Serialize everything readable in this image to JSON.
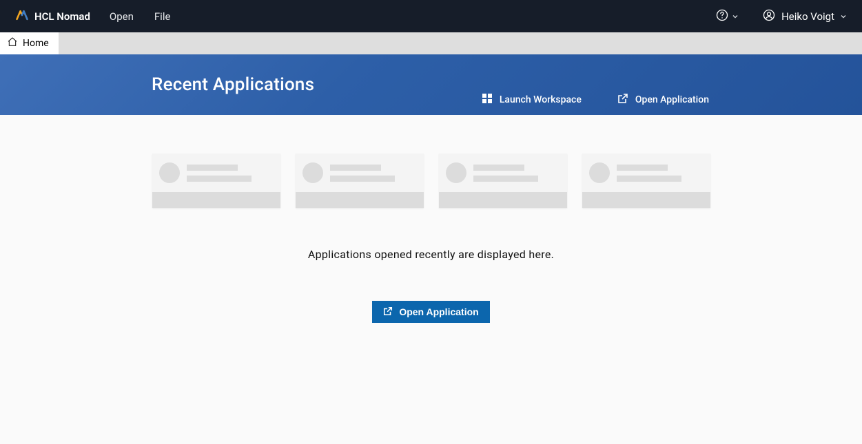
{
  "topbar": {
    "brand": "HCL Nomad",
    "menu": {
      "open": "Open",
      "file": "File"
    },
    "user_name": "Heiko Voigt"
  },
  "tabs": {
    "home": "Home"
  },
  "hero": {
    "title": "Recent Applications",
    "actions": {
      "launch_workspace": "Launch Workspace",
      "open_application": "Open Application"
    }
  },
  "content": {
    "empty_message": "Applications opened recently are displayed here.",
    "cta_label": "Open Application"
  }
}
